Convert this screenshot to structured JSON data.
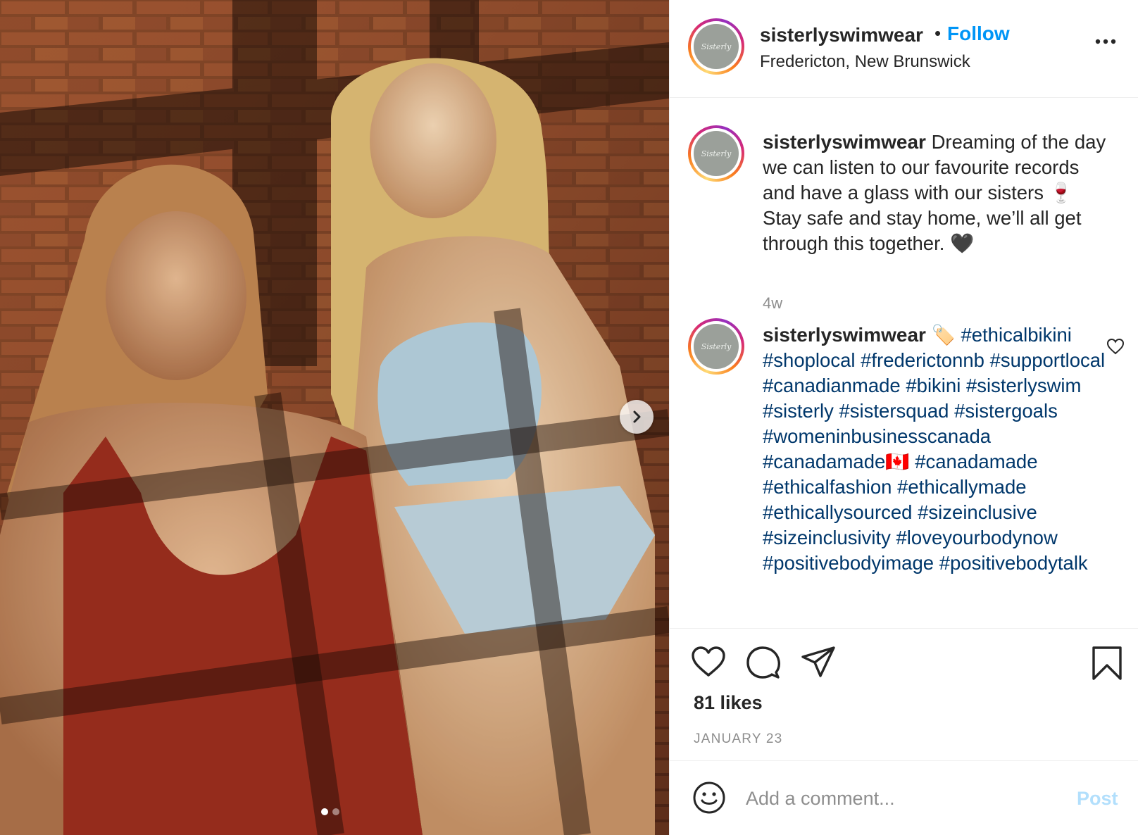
{
  "photo": {
    "alt": "Two women in swimwear sitting against a brick wall in window light",
    "carousel": {
      "current": 1,
      "total": 2
    },
    "next_icon": "chevron-right-icon"
  },
  "header": {
    "username": "sisterlyswimwear",
    "separator": "•",
    "follow_label": "Follow",
    "location": "Fredericton, New Brunswick",
    "avatar_text": "Sisterly",
    "more_icon": "more-horizontal-icon"
  },
  "caption": {
    "username": "sisterlyswimwear",
    "text": "Dreaming of the day we can listen to our favourite records and have a glass with our sisters 🍷 Stay safe and stay home, we’ll all get through this together. 🖤",
    "time": "4w"
  },
  "hashtag_comment": {
    "username": "sisterlyswimwear",
    "emoji": "🏷️",
    "tags": [
      "#ethicalbikini",
      "#shoplocal",
      "#frederictonnb",
      "#supportlocal",
      "#canadianmade",
      "#bikini",
      "#sisterlyswim",
      "#sisterly",
      "#sistersquad",
      "#sistergoals",
      "#womeninbusinesscanada",
      "#canadamade🇨🇦",
      "#canadamade",
      "#ethicalfashion",
      "#ethicallymade",
      "#ethicallysourced",
      "#sizeinclusive",
      "#sizeinclusivity",
      "#loveyourbodynow",
      "#positivebodyimage",
      "#positivebodytalk"
    ],
    "like_icon": "heart-outline-icon"
  },
  "actions": {
    "icons": [
      "heart-icon",
      "comment-icon",
      "share-icon",
      "bookmark-icon"
    ],
    "likes": "81 likes",
    "date": "JANUARY 23"
  },
  "add_comment": {
    "placeholder": "Add a comment...",
    "post_label": "Post",
    "emoji_icon": "smiley-icon"
  },
  "colors": {
    "link": "#0095f6",
    "hashtag": "#00376b",
    "muted": "#8e8e8e",
    "post_disabled": "#b2dffc"
  }
}
